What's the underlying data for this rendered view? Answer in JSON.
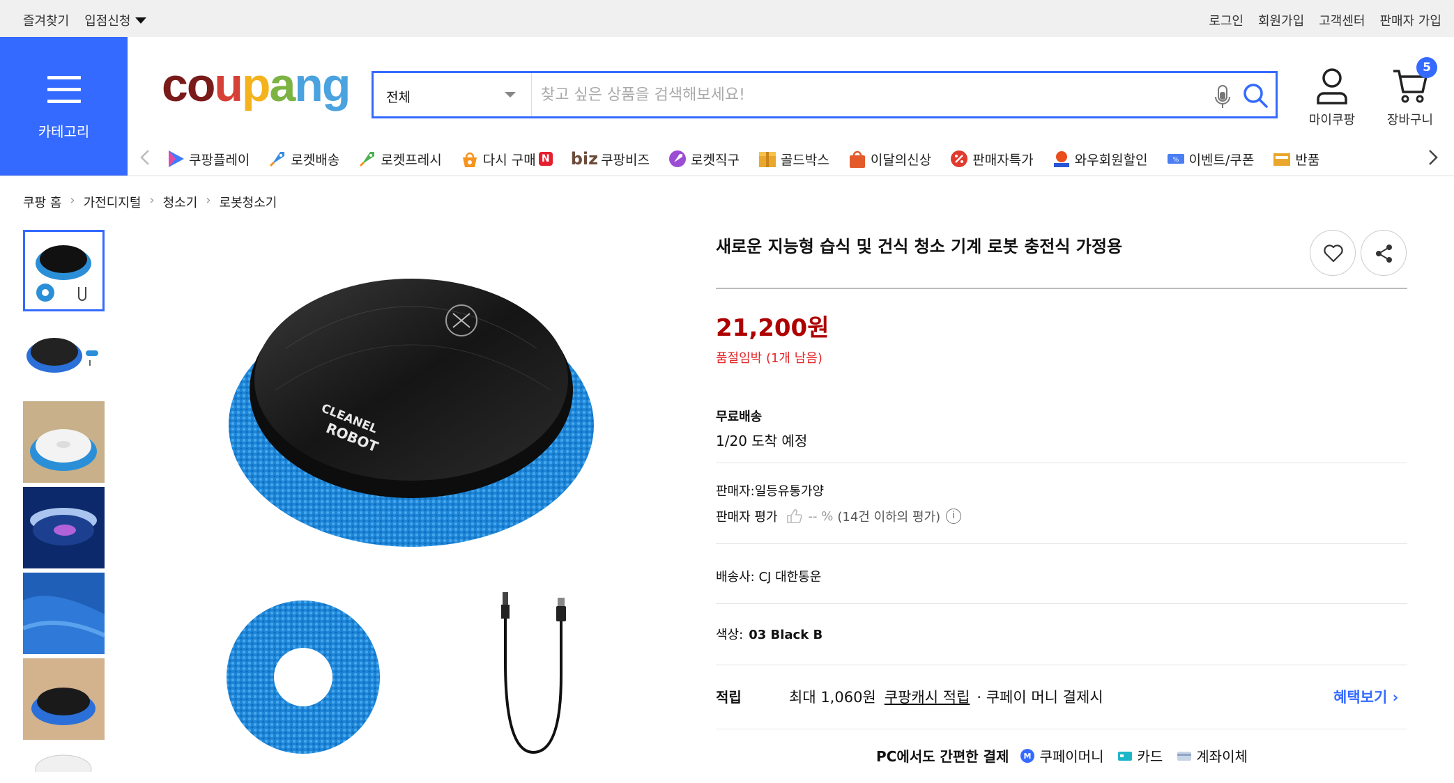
{
  "topbar": {
    "left": [
      "즐겨찾기",
      "입점신청"
    ],
    "right": [
      "로그인",
      "회원가입",
      "고객센터",
      "판매자 가입"
    ]
  },
  "header": {
    "category_label": "카테고리",
    "logo": [
      "c",
      "o",
      "u",
      "p",
      "a",
      "n",
      "g"
    ],
    "search": {
      "scope": "전체",
      "placeholder": "찾고 싶은 상품을 검색해보세요!"
    },
    "my_coupang": "마이쿠팡",
    "cart": {
      "label": "장바구니",
      "count": "5"
    }
  },
  "nav": {
    "items": [
      {
        "label": "쿠팡플레이",
        "icon": "play-icon",
        "color": "#3f7bff"
      },
      {
        "label": "로켓배송",
        "icon": "rocket-icon",
        "color": "#3a8dde"
      },
      {
        "label": "로켓프레시",
        "icon": "rocket-fresh-icon",
        "color": "#4caf50"
      },
      {
        "label": "다시 구매",
        "icon": "rebuy-icon",
        "color": "#f7931e"
      },
      {
        "label": "쿠팡비즈",
        "prefix": "biz"
      },
      {
        "label": "로켓직구",
        "icon": "global-rocket-icon",
        "color": "#9c4dd4"
      },
      {
        "label": "골드박스",
        "icon": "gold-box-icon",
        "color": "#e9a82c"
      },
      {
        "label": "이달의신상",
        "icon": "new-bag-icon",
        "color": "#e45a2a"
      },
      {
        "label": "판매자특가",
        "icon": "percent-icon",
        "color": "#e03b2e"
      },
      {
        "label": "와우회원할인",
        "icon": "wow-icon",
        "color": "#e94e1b"
      },
      {
        "label": "이벤트/쿠폰",
        "icon": "coupon-icon",
        "color": "#4a7ef2"
      },
      {
        "label": "반품",
        "icon": "return-icon",
        "color": "#e9a82c"
      }
    ],
    "rebuy_badge": "N"
  },
  "breadcrumb": [
    "쿠팡 홈",
    "가전디지털",
    "청소기",
    "로봇청소기"
  ],
  "product": {
    "title": "새로운 지능형 습식 및 건식 청소 기계 로봇 충전식 가정용",
    "price": "21,200원",
    "stock_note": "품절임박 (1개 남음)",
    "shipping_title": "무료배송",
    "shipping_date": "1/20 도착 예정",
    "seller": "판매자:일등유통가양",
    "rating_label": "판매자 평가",
    "rating_value": "-- %",
    "rating_note": "(14건 이하의 평가)",
    "carrier": "배송사:  CJ 대한통운",
    "color_label": "색상:",
    "color_value": "03 Black B",
    "reward_label": "적립",
    "reward_max": "최대 1,060원",
    "reward_link": "쿠팡캐시 적립",
    "reward_rest": "· 쿠페이 머니 결제시",
    "benefit_link": "혜택보기",
    "pay_title": "PC에서도 간편한 결제",
    "pay_methods": [
      "쿠페이머니",
      "카드",
      "계좌이체"
    ]
  },
  "colors": {
    "accent": "#346aff",
    "price": "#ae0000",
    "stock": "#e52528"
  }
}
